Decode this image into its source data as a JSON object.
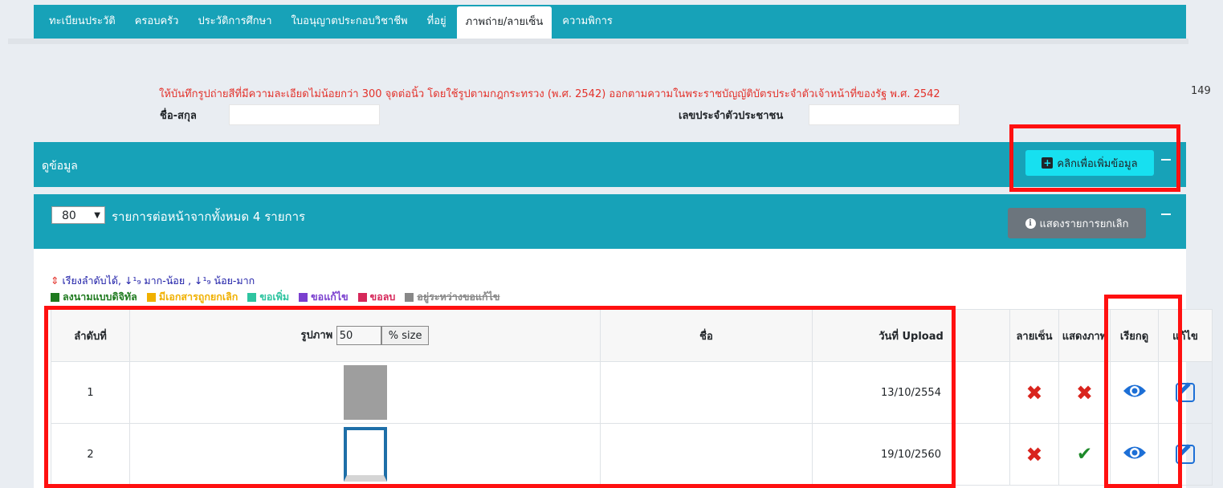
{
  "tabs": [
    "ทะเบียนประวัติ",
    "ครอบครัว",
    "ประวัติการศึกษา",
    "ใบอนุญาตประกอบวิชาชีพ",
    "ที่อยู่",
    "ภาพถ่าย/ลายเซ็น",
    "ความพิการ"
  ],
  "notice": "ให้บันทึกรูปถ่ายสีที่มีความละเอียดไม่น้อยกว่า 300 จุดต่อนิ้ว โดยใช้รูปตามกฎกระทรวง (พ.ศ. 2542) ออกตามความในพระราชบัญญัติบัตรประจำตัวเจ้าหน้าที่ของรัฐ พ.ศ. 2542",
  "page_number": "149",
  "labels": {
    "name": "ชื่อ-สกุล",
    "id_number": "เลขประจำตัวประชาชน"
  },
  "panel_view": {
    "title": "ดูข้อมูล",
    "add_button": "คลิกเพื่อเพิ่มข้อมูล"
  },
  "list": {
    "per_page_value": "80",
    "per_page_text": "รายการต่อหน้าจากทั้งหมด 4 รายการ",
    "show_cancelled_button": "แสดงรายการยกเลิก"
  },
  "sort_hint": {
    "arrow": "⇕",
    "text": " เรียงลำดับได้, ↓¹₉ มาก-น้อย , ↓¹₉ น้อย-มาก"
  },
  "legend": [
    {
      "label": "ลงนามแบบดิจิทัล",
      "color": "#1f7a1f"
    },
    {
      "label": "มีเอกสารถูกยกเลิก",
      "color": "#f0b000"
    },
    {
      "label": "ขอเพิ่ม",
      "color": "#2ec4a0"
    },
    {
      "label": "ขอแก้ไข",
      "color": "#7a3fcf"
    },
    {
      "label": "ขอลบ",
      "color": "#d6285a"
    },
    {
      "label": "อยู่ระหว่างขอแก้ไข",
      "color": "#888888"
    }
  ],
  "table": {
    "headers": {
      "order": "ลำดับที่",
      "image": "รูปภาพ",
      "size_value": "50",
      "size_button": "% size",
      "name": "ชื่อ",
      "upload_date": "วันที่ Upload",
      "signature": "ลายเซ็น",
      "show_image": "แสดงภาพ",
      "view": "เรียกดู",
      "edit": "แก้ไข"
    },
    "rows": [
      {
        "order": "1",
        "name": "",
        "upload_date": "13/10/2554",
        "signature": "no",
        "show_image": "no"
      },
      {
        "order": "2",
        "name": "",
        "upload_date": "19/10/2560",
        "signature": "no",
        "show_image": "yes"
      }
    ]
  },
  "icons": {
    "view": "eye-icon",
    "edit": "edit-icon",
    "add": "plus-square-icon",
    "info": "info-circle-icon"
  },
  "colors": {
    "header_teal": "#17a2b8",
    "add_button": "#17e0f0",
    "annotation_red": "#ff1010",
    "notice_red": "#e3312a"
  }
}
